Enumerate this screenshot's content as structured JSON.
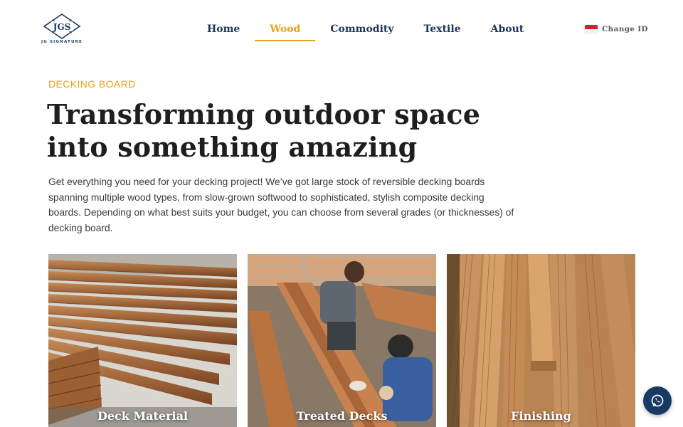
{
  "brand": {
    "logo_monogram": "JGS",
    "logo_tagline": "JG SIGNATURE"
  },
  "nav": {
    "items": [
      {
        "label": "Home",
        "active": false
      },
      {
        "label": "Wood",
        "active": true
      },
      {
        "label": "Commodity",
        "active": false
      },
      {
        "label": "Textile",
        "active": false
      },
      {
        "label": "About",
        "active": false
      }
    ],
    "accent_color": "#eaa21c",
    "text_color": "#1d3557"
  },
  "language": {
    "label": "Change ID",
    "flag_icon": "indonesia-flag-icon"
  },
  "hero": {
    "eyebrow": "DECKING BOARD",
    "title": "Transforming outdoor space into something amazing",
    "description": "Get everything you need for your decking project! We’ve got large stock of reversible decking boards spanning multiple wood types, from slow-grown softwood to sophisticated, stylish composite decking boards. Depending on what best suits your budget, you can choose from several grades (or thicknesses) of decking board."
  },
  "cards": [
    {
      "label": "Deck Material"
    },
    {
      "label": "Treated Decks"
    },
    {
      "label": "Finishing"
    }
  ],
  "floating": {
    "chat_icon": "whatsapp-icon"
  }
}
